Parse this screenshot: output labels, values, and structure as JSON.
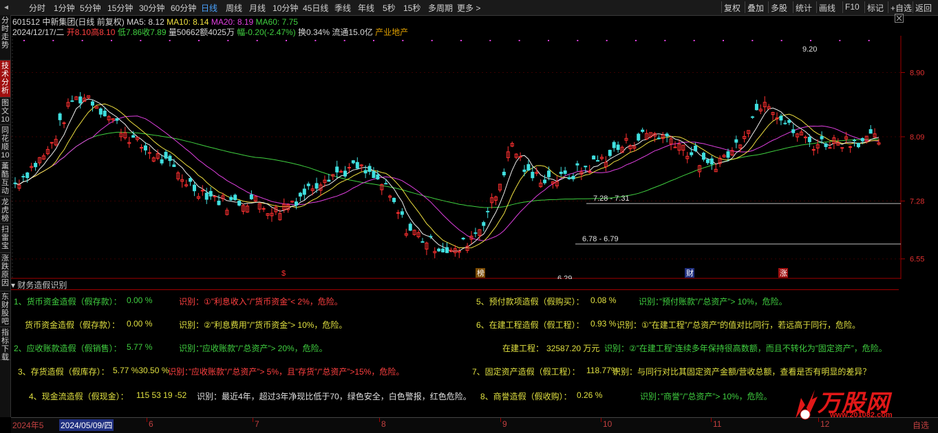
{
  "toolbar": {
    "periods": [
      "分时",
      "1分钟",
      "5分钟",
      "15分钟",
      "30分钟",
      "60分钟",
      "日线",
      "周线",
      "月线",
      "10分钟",
      "45日线",
      "季线",
      "年线",
      "5秒",
      "15秒",
      "多周期",
      "更多 >"
    ],
    "active": "日线",
    "right": [
      "复权",
      "叠加",
      "多股",
      "统计",
      "画线",
      "F10",
      "标记",
      "+自选",
      "返回"
    ]
  },
  "sidebar": [
    "分时走势",
    "技术分析",
    "图文10",
    "同花顺10",
    "薰酷互动",
    "龙虎榜",
    "扫雷宝",
    "涨跌原因",
    "东财股吧",
    "指标下载"
  ],
  "stock": {
    "code": "601512",
    "name": "中新集团(日线 前复权)",
    "ma5": "MA5: 8.12",
    "ma10": "MA10: 8.14",
    "ma20": "MA20: 8.19",
    "ma60": "MA60: 7.75",
    "date": "2024/12/17/二",
    "open": "开8.10",
    "high": "高8.10",
    "low": "低7.86",
    "close": "收7.89",
    "volume": "量50662",
    "amount": "额4025万",
    "change": "幅-0.20(-2.47%)",
    "turnover": "换0.34%",
    "float": "流通15.0亿",
    "sector": "产业地产"
  },
  "chart_data": {
    "type": "candlestick",
    "y_ticks": [
      "8.90",
      "8.09",
      "7.28",
      "6.55"
    ],
    "annotations": [
      "9.20",
      "7.28 - 7.31",
      "6.78 - 6.79",
      "6.29"
    ],
    "markers": [
      "$",
      "榜",
      "财",
      "涨"
    ],
    "colors": {
      "up": "#ff3030",
      "down": "#40e0e0",
      "ma5": "#f0f0f0",
      "ma10": "#f0e040",
      "ma20": "#e040e0",
      "ma60": "#40d040"
    }
  },
  "panel": {
    "title": "财务造假识别",
    "rows": [
      {
        "t": "1、货币资金造假（假存款）：",
        "v": "0.00 %",
        "n": "识别：①”利息收入”/”货币资金”< 2%，危险。"
      },
      {
        "t": "货币资金造假（假存款）：",
        "v": "0.00 %",
        "n": "识别：②”利息费用”/”货币资金”> 10%，危险。"
      },
      {
        "t": "2、应收账款造假（假销售）：",
        "v": "5.77 %",
        "n": "识别：”应收账款”/”总资产”> 20%，危险。"
      },
      {
        "t": "3、存货造假（假库存）：",
        "v": "5.77 %30.50 %",
        "n": "识别：”应收账款”/”总资产”> 5%，且”存货”/”总资产”>15%，危险。"
      },
      {
        "t": "4、现金流造假（假现金）：",
        "v": "115 53 19 -52",
        "n": "识别：最近4年，超过3年净现比低于70，绿色安全，白色警报，红色危险。"
      },
      {
        "t": "5、预付款项造假（假购买）：",
        "v": "0.08 %",
        "n": "识别：”预付账款”/”总资产”> 10%，危险。"
      },
      {
        "t": "6、在建工程造假（假工程）：",
        "v": "0.93 %",
        "n": "识别：①”在建工程”/”总资产”的值对比同行，若远高于同行，危险。"
      },
      {
        "t": "在建工程：",
        "v": "32587.20 万元",
        "n": "识别：②”在建工程”连续多年保持很高数额，而且不转化为”固定资产”，危险。"
      },
      {
        "t": "7、固定资产造假（假工程）：",
        "v": "118.77%",
        "n": "识别：与同行对比其固定资产金额/营收总额，查看是否有明显的差异？"
      },
      {
        "t": "8、商誉造假（假收购）：",
        "v": "0.26 %",
        "n": "识别：”商誉”/”总资产”> 10%，危险。"
      }
    ]
  },
  "dates": [
    "2024年5",
    "2024/05/09/四",
    "6",
    "7",
    "8",
    "9",
    "10",
    "11",
    "12",
    "自选"
  ],
  "watermark": {
    "brand": "万股网",
    "url": "www.201082.com"
  }
}
